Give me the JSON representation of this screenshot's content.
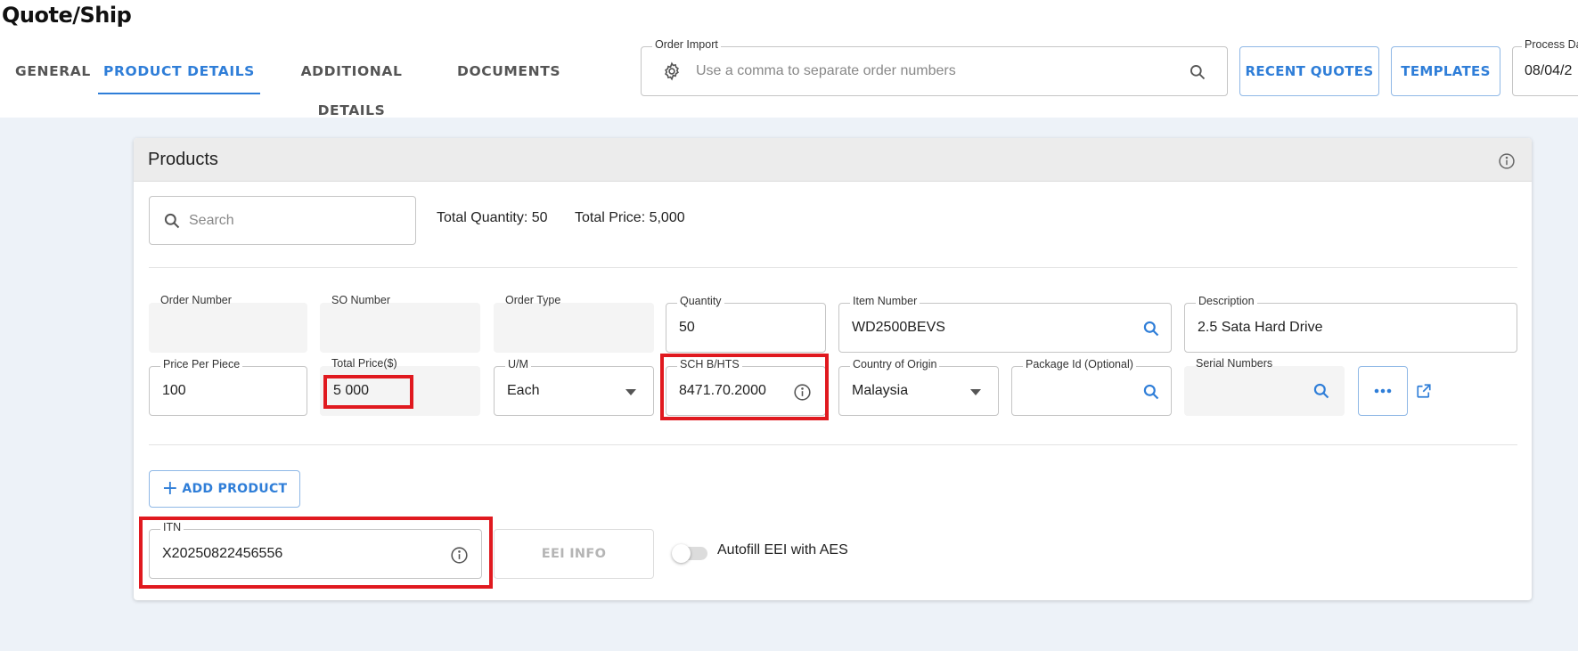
{
  "app": {
    "title": "Quote/Ship"
  },
  "tabs": [
    {
      "label": "GENERAL",
      "active": false
    },
    {
      "label": "PRODUCT DETAILS",
      "active": true
    },
    {
      "label": "ADDITIONAL DETAILS",
      "active": false
    },
    {
      "label": "DOCUMENTS",
      "active": false
    }
  ],
  "order_import": {
    "label": "Order Import",
    "placeholder": "Use a comma to separate order numbers",
    "left_icon": "gear-icon",
    "right_icon": "search-icon"
  },
  "header_buttons": {
    "recent_quotes": "RECENT QUOTES",
    "templates": "TEMPLATES"
  },
  "process_date": {
    "label": "Process Da",
    "value": "08/04/2"
  },
  "products": {
    "title": "Products",
    "info_icon": "info-icon",
    "search_placeholder": "Search",
    "total_quantity": "Total Quantity: 50",
    "total_price": "Total Price: 5,000",
    "fields": {
      "order_number": {
        "label": "Order Number",
        "value": ""
      },
      "so_number": {
        "label": "SO Number",
        "value": ""
      },
      "order_type": {
        "label": "Order Type",
        "value": ""
      },
      "quantity": {
        "label": "Quantity",
        "value": "50"
      },
      "item_number": {
        "label": "Item Number",
        "value": "WD2500BEVS"
      },
      "description": {
        "label": "Description",
        "value": "2.5 Sata Hard Drive"
      },
      "price_per_piece": {
        "label": "Price Per Piece",
        "value": "100"
      },
      "total_price": {
        "label": "Total Price($)",
        "value": "5 000"
      },
      "um": {
        "label": "U/M",
        "value": "Each"
      },
      "sch_hts": {
        "label": "SCH B/HTS",
        "value": "8471.70.2000"
      },
      "country_of_origin": {
        "label": "Country of Origin",
        "value": "Malaysia"
      },
      "package_id": {
        "label": "Package Id (Optional)",
        "value": ""
      },
      "serial_numbers": {
        "label": "Serial Numbers",
        "value": ""
      }
    },
    "add_product": "ADD PRODUCT",
    "itn": {
      "label": "ITN",
      "value": "X20250822456556"
    },
    "eei_info": "EEI INFO",
    "autofill_label": "Autofill EEI with AES",
    "autofill_on": false
  },
  "colors": {
    "accent": "#2f7ed8",
    "highlight": "#e0191f",
    "background": "#edf2f8"
  }
}
